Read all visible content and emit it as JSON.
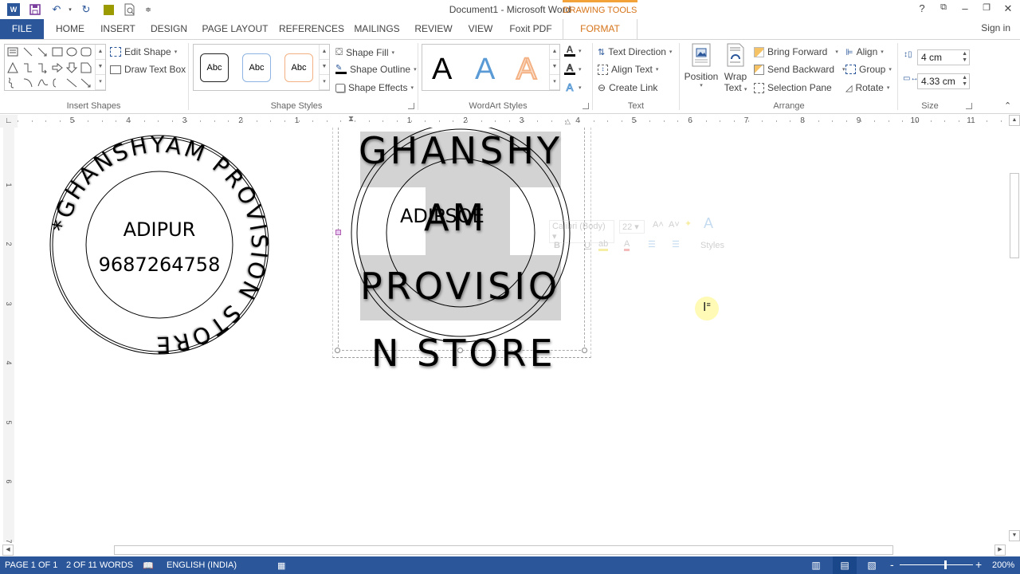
{
  "titlebar": {
    "document_title": "Document1 - Microsoft Word",
    "contextual_tab_group": "DRAWING TOOLS",
    "qat": [
      "word-logo-icon",
      "save-icon",
      "undo-icon",
      "redo-icon",
      "color-swatch-icon",
      "print-preview-icon",
      "customize-qat-icon"
    ],
    "window_controls": {
      "help": "?",
      "ribbon_options": "⧉",
      "minimize": "–",
      "restore": "❐",
      "close": "✕"
    }
  },
  "tabs": [
    {
      "label": "FILE"
    },
    {
      "label": "HOME"
    },
    {
      "label": "INSERT"
    },
    {
      "label": "DESIGN"
    },
    {
      "label": "PAGE LAYOUT"
    },
    {
      "label": "REFERENCES"
    },
    {
      "label": "MAILINGS"
    },
    {
      "label": "REVIEW"
    },
    {
      "label": "VIEW"
    },
    {
      "label": "Foxit PDF"
    },
    {
      "label": "FORMAT"
    }
  ],
  "active_tab": "FORMAT",
  "sign_in": "Sign in",
  "ribbon": {
    "insert_shapes": {
      "label": "Insert Shapes",
      "edit_shape": "Edit Shape",
      "draw_text_box": "Draw Text Box"
    },
    "shape_styles": {
      "label": "Shape Styles",
      "presets": [
        "Abc",
        "Abc",
        "Abc"
      ],
      "shape_fill": "Shape Fill",
      "shape_outline": "Shape Outline",
      "shape_effects": "Shape Effects"
    },
    "wordart_styles": {
      "label": "WordArt Styles",
      "presets": [
        "A",
        "A",
        "A"
      ],
      "colors": {
        "black": "#000000",
        "blue": "#5b9bd5",
        "orange": "#f4b183"
      }
    },
    "text": {
      "label": "Text",
      "text_direction": "Text Direction",
      "align_text": "Align Text",
      "create_link": "Create Link"
    },
    "arrange": {
      "label": "Arrange",
      "position": "Position",
      "wrap_text_line1": "Wrap",
      "wrap_text_line2": "Text",
      "bring_forward": "Bring Forward",
      "send_backward": "Send Backward",
      "selection_pane": "Selection Pane",
      "align": "Align",
      "group": "Group",
      "rotate": "Rotate"
    },
    "size": {
      "label": "Size",
      "height": "4 cm",
      "width": "4.33 cm"
    }
  },
  "ruler": {
    "horizontal_labels_left": [
      "5",
      "4",
      "3",
      "2",
      "1"
    ],
    "horizontal_labels_right": [
      "1",
      "2",
      "3",
      "4",
      "5",
      "6",
      "7",
      "8",
      "9",
      "10",
      "11"
    ],
    "vertical_labels": [
      "1",
      "2",
      "3",
      "4",
      "5",
      "6",
      "7"
    ]
  },
  "document": {
    "stamp1": {
      "ring_text": "*GHANSHYAM PROVISION STORE",
      "center_line1": "ADIPUR",
      "center_line2": "9687264758"
    },
    "stamp2": {
      "line1": "GHANSHY",
      "line2": "AM",
      "line3": "PROVISIO",
      "line4": "N STORE",
      "overlap_text": "ADIPSOE"
    }
  },
  "mini_toolbar": {
    "font": "Calibri (Body)",
    "size": "22",
    "bold": "B",
    "italic": "I",
    "underline": "U",
    "styles": "Styles"
  },
  "statusbar": {
    "page": "PAGE 1 OF 1",
    "words": "2 OF 11 WORDS",
    "language": "ENGLISH (INDIA)",
    "zoom_level": "200%",
    "zoom_minus": "-",
    "zoom_plus": "+",
    "zoom_slider_fraction": 0.62
  }
}
